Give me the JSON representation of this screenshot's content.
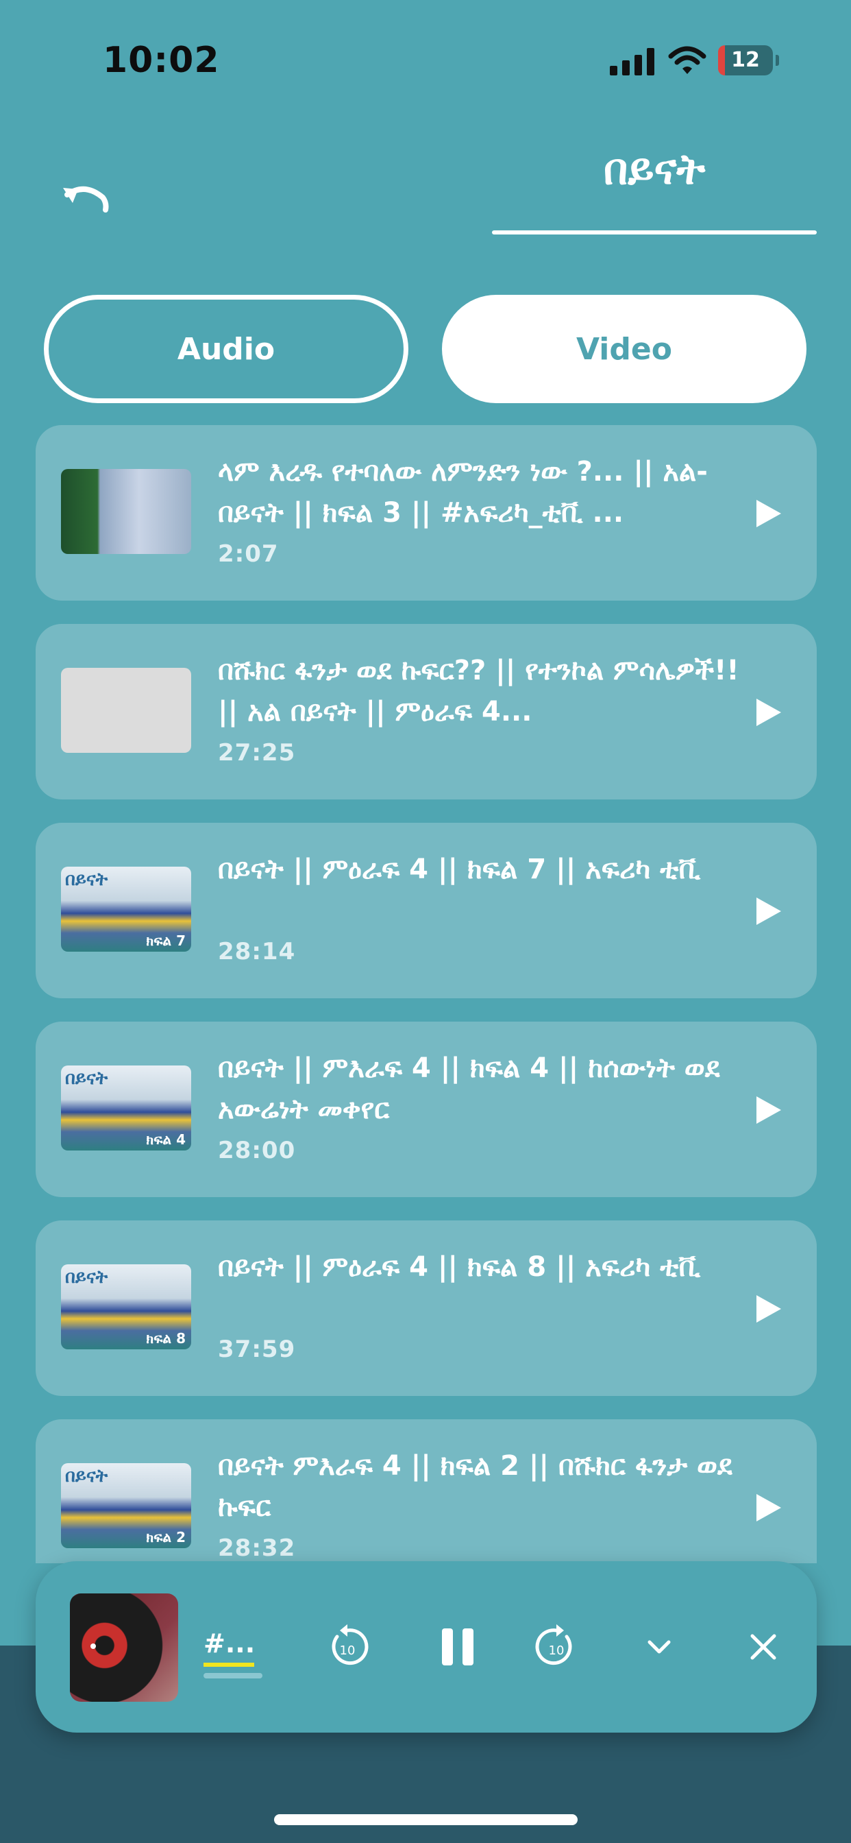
{
  "status_bar": {
    "time": "10:02",
    "battery": "12"
  },
  "header": {
    "title": "በይናት"
  },
  "tabs": {
    "audio": "Audio",
    "video": "Video",
    "selected": "Video"
  },
  "videos": [
    {
      "title": "ላም እረዱ የተባለው ለምንድን ነው ?... || አል-በይናት || ክፍል 3 || #አፍሪካ_ቲቪ ...",
      "duration": "2:07"
    },
    {
      "title": "በሹክር ፋንታ ወደ ኩፍር?? || የተንኮል ምሳሌዎች!! || አል በይናት || ምዕራፍ 4...",
      "duration": "27:25"
    },
    {
      "title": "በይናት  || ምዕራፍ 4 || ክፍል 7 || አፍሪካ ቲቪ",
      "duration": "28:14"
    },
    {
      "title": "በይናት || ምእራፍ 4 || ክፍል 4 || ከሰውነት ወደ አውሬነት መቀየር",
      "duration": "28:00"
    },
    {
      "title": "በይናት || ምዕራፍ 4 || ክፍል 8 || አፍሪካ ቲቪ",
      "duration": "37:59"
    },
    {
      "title": "በይናት ምእራፍ 4 || ክፍል 2 || በሹክር ፋንታ ወደ ኩፍር",
      "duration": "28:32"
    }
  ],
  "player": {
    "title": "#...",
    "state": "playing"
  },
  "icons": {
    "back": "undo-arrow-icon",
    "play": "play-icon",
    "rewind": "rewind-10-icon",
    "pause": "pause-icon",
    "forward": "forward-10-icon",
    "collapse": "chevron-down-icon",
    "close": "close-icon"
  },
  "colors": {
    "background": "#4fa6b2",
    "card": "#76b9c3",
    "accent": "#4fa3b0",
    "bottom": "#2b5868"
  }
}
